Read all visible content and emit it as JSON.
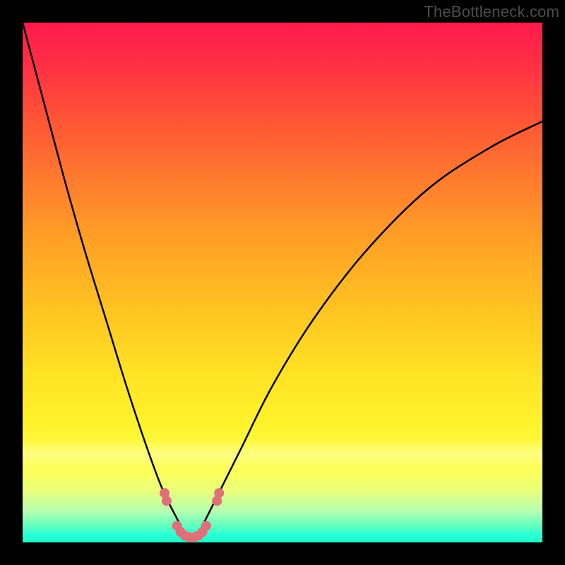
{
  "watermark": "TheBottleneck.com",
  "colors": {
    "frame": "#000000",
    "curve": "#000000",
    "marker": "#e07078"
  },
  "chart_data": {
    "type": "line",
    "title": "",
    "xlabel": "",
    "ylabel": "",
    "xlim": [
      0,
      100
    ],
    "ylim": [
      0,
      100
    ],
    "note": "Bottleneck-style v-curve on a red→green vertical gradient. Minimum sits near x≈32.5; values are estimates read off the image since there are no axes or labels.",
    "series": [
      {
        "name": "bottleneck-curve",
        "x": [
          0,
          4,
          8,
          12,
          16,
          20,
          24,
          27,
          30,
          31.5,
          33.5,
          35,
          38,
          42,
          48,
          56,
          66,
          78,
          90,
          100
        ],
        "y": [
          100,
          85,
          70,
          56,
          43,
          30,
          18,
          10,
          4,
          1,
          1,
          4,
          10,
          18,
          30,
          43,
          56,
          68,
          76,
          81
        ]
      }
    ],
    "markers": {
      "name": "bottom-dots",
      "x": [
        27.3,
        27.7,
        29.7,
        30.4,
        31.2,
        32.0,
        33.0,
        33.8,
        34.6,
        35.3,
        37.4,
        37.8
      ],
      "y": [
        9.5,
        8.0,
        3.2,
        2.0,
        1.3,
        1.0,
        1.0,
        1.3,
        2.0,
        3.2,
        8.0,
        9.5
      ]
    }
  }
}
